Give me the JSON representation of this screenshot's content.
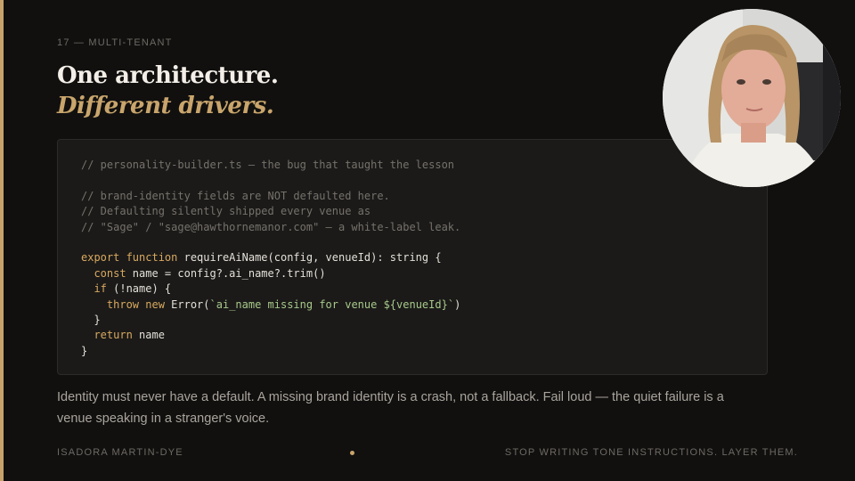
{
  "slide": {
    "eyebrow": "17 — MULTI-TENANT",
    "title_line1": "One architecture.",
    "title_line2": "Different drivers.",
    "code": {
      "lines": [
        [
          {
            "t": "// personality-builder.ts — the bug that taught the lesson",
            "c": "comment"
          }
        ],
        [],
        [
          {
            "t": "// brand-identity fields are NOT defaulted here.",
            "c": "comment"
          }
        ],
        [
          {
            "t": "// Defaulting silently shipped every venue as",
            "c": "comment"
          }
        ],
        [
          {
            "t": "// \"Sage\" / \"sage@hawthornemanor.com\" — a white-label leak.",
            "c": "comment"
          }
        ],
        [],
        [
          {
            "t": "export function",
            "c": "kw"
          },
          {
            "t": " requireAiName(config, venueId): string {",
            "c": "plain"
          }
        ],
        [
          {
            "t": "  ",
            "c": "plain"
          },
          {
            "t": "const",
            "c": "kw"
          },
          {
            "t": " name = config?.ai_name?.trim()",
            "c": "plain"
          }
        ],
        [
          {
            "t": "  ",
            "c": "plain"
          },
          {
            "t": "if",
            "c": "kw"
          },
          {
            "t": " (!name) {",
            "c": "plain"
          }
        ],
        [
          {
            "t": "    ",
            "c": "plain"
          },
          {
            "t": "throw new",
            "c": "kw"
          },
          {
            "t": " Error(",
            "c": "plain"
          },
          {
            "t": "`ai_name missing for venue ${venueId}`",
            "c": "str"
          },
          {
            "t": ")",
            "c": "plain"
          }
        ],
        [
          {
            "t": "  }",
            "c": "plain"
          }
        ],
        [
          {
            "t": "  ",
            "c": "plain"
          },
          {
            "t": "return",
            "c": "kw"
          },
          {
            "t": " name",
            "c": "plain"
          }
        ],
        [
          {
            "t": "}",
            "c": "plain"
          }
        ]
      ]
    },
    "body": "Identity must never have a default. A missing brand identity is a crash, not a fallback. Fail loud — the quiet failure is a venue speaking in a stranger's voice.",
    "footer_left": "ISADORA MARTIN-DYE",
    "footer_right": "STOP WRITING TONE INSTRUCTIONS. LAYER THEM."
  },
  "colors": {
    "accent": "#c9a56c",
    "background": "#11100f",
    "code_background": "#1b1a19"
  },
  "webcam": {
    "icon": "presenter-video-feed"
  }
}
